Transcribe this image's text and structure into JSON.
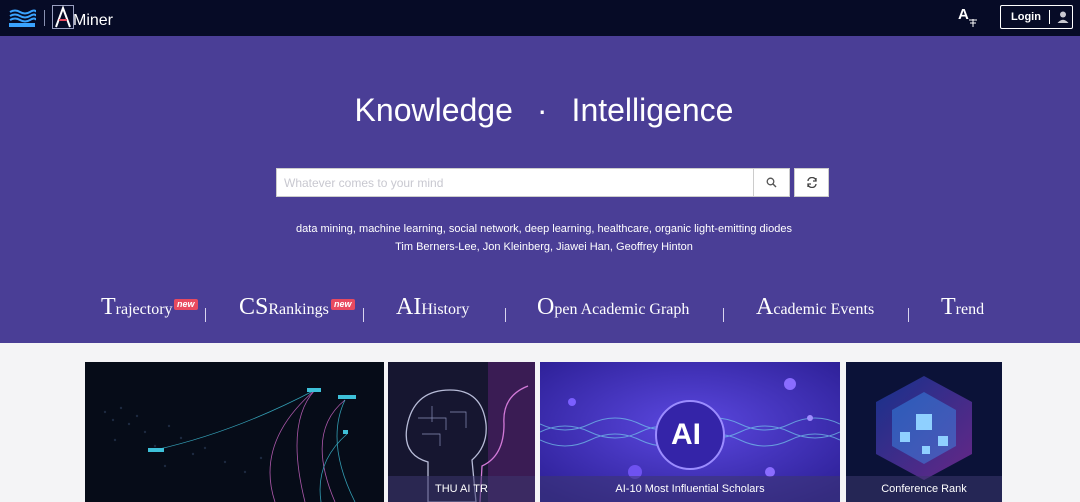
{
  "header": {
    "brand": "Miner",
    "lang_label": "A",
    "login_label": "Login",
    "icons": {
      "brand_mark": "wave-logo-icon",
      "language": "translate-icon",
      "user": "user-icon"
    }
  },
  "hero": {
    "slogan_left": "Knowledge",
    "slogan_dot": "·",
    "slogan_right": "Intelligence",
    "search_placeholder": "Whatever comes to your mind",
    "search_value": "",
    "hot_topics": "data mining, machine learning, social network, deep learning, healthcare, organic light-emitting diodes",
    "hot_scholars": "Tim Berners-Lee, Jon Kleinberg, Jiawei Han, Geoffrey Hinton",
    "background_color": "#4a3e96"
  },
  "nav": [
    {
      "big": "T",
      "small": "rajectory",
      "badge": "new"
    },
    {
      "big": "CS",
      "small": "Rankings",
      "badge": "new"
    },
    {
      "big": "AI",
      "small": "History",
      "badge": ""
    },
    {
      "big": "O",
      "small": "pen Academic Graph",
      "badge": ""
    },
    {
      "big": "A",
      "small": "cademic Events",
      "badge": ""
    },
    {
      "big": "T",
      "small": "rend",
      "badge": ""
    }
  ],
  "cards": [
    {
      "caption": ""
    },
    {
      "caption": "THU AI TR"
    },
    {
      "caption": "AI-10 Most Influential Scholars",
      "image_text": "AI"
    },
    {
      "caption": "Conference Rank"
    }
  ]
}
